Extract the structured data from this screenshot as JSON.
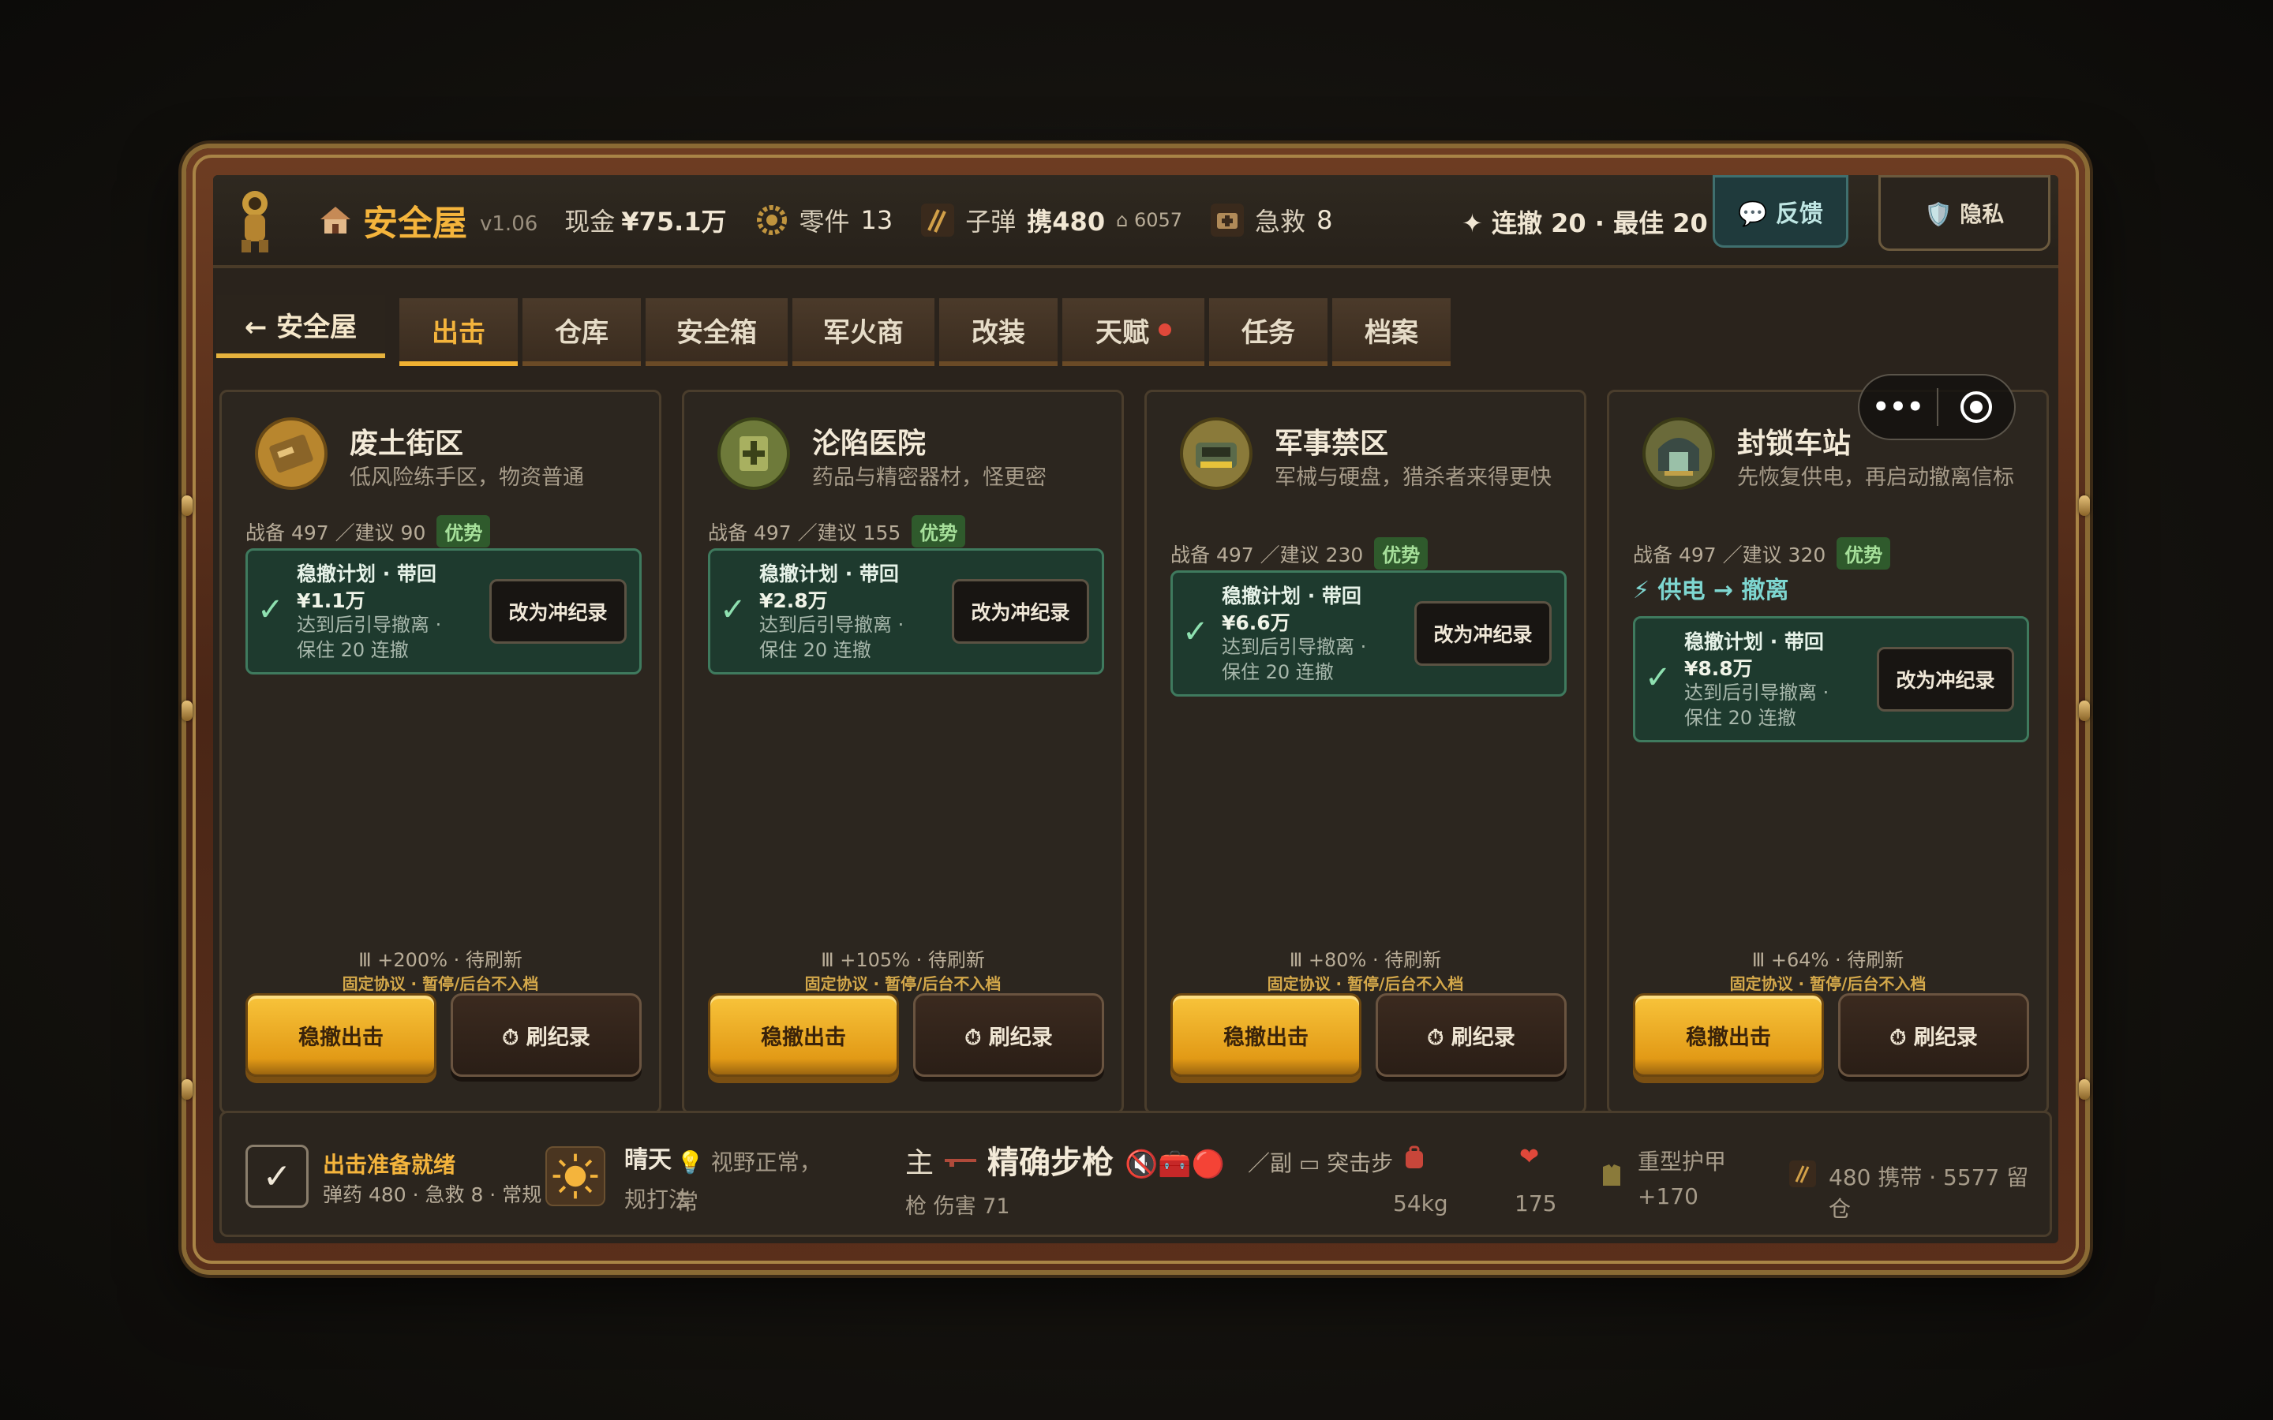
{
  "header": {
    "title": "安全屋",
    "version": "v1.06",
    "cash_label": "现金",
    "cash_value": "¥75.1万",
    "parts_label": "零件",
    "parts_value": "13",
    "ammo_label": "子弹",
    "ammo_carry": "携480",
    "ammo_stash": "⌂ 6057",
    "aid_label": "急救",
    "aid_value": "8",
    "streak": "✦ 连撤 20 · 最佳 20",
    "feedback": "💬 反馈",
    "privacy": "🛡️ 隐私"
  },
  "tabs": {
    "back": "← 安全屋",
    "items": [
      "出击",
      "仓库",
      "安全箱",
      "军火商",
      "改装",
      "天赋",
      "任务",
      "档案"
    ],
    "active": "出击"
  },
  "capsule": {
    "more": "•••"
  },
  "cards": [
    {
      "name": "废土街区",
      "desc": "低风险练手区，物资普通",
      "stats": "战备 497 ／建议 90",
      "badge": "优势",
      "plan_title": "稳撤计划 · 带回",
      "plan_amount": "¥1.1万",
      "plan_note": "达到后引导撤离 · 保住 20 连撤",
      "plan_button": "改为冲纪录",
      "power": "",
      "mods": "Ⅲ +200% · 待刷新",
      "protocol": "固定协议 · 暂停/后台不入档",
      "go": "稳撤出击",
      "record": "⏱ 刷纪录"
    },
    {
      "name": "沦陷医院",
      "desc": "药品与精密器材，怪更密",
      "stats": "战备 497 ／建议 155",
      "badge": "优势",
      "plan_title": "稳撤计划 · 带回",
      "plan_amount": "¥2.8万",
      "plan_note": "达到后引导撤离 · 保住 20 连撤",
      "plan_button": "改为冲纪录",
      "power": "",
      "mods": "Ⅲ +105% · 待刷新",
      "protocol": "固定协议 · 暂停/后台不入档",
      "go": "稳撤出击",
      "record": "⏱ 刷纪录"
    },
    {
      "name": "军事禁区",
      "desc": "军械与硬盘，猎杀者来得更快",
      "stats": "战备 497 ／建议 230",
      "badge": "优势",
      "plan_title": "稳撤计划 · 带回",
      "plan_amount": "¥6.6万",
      "plan_note": "达到后引导撤离 · 保住 20 连撤",
      "plan_button": "改为冲纪录",
      "power": "",
      "mods": "Ⅲ +80% · 待刷新",
      "protocol": "固定协议 · 暂停/后台不入档",
      "go": "稳撤出击",
      "record": "⏱ 刷纪录"
    },
    {
      "name": "封锁车站",
      "desc": "先恢复供电，再启动撤离信标",
      "stats": "战备 497 ／建议 320",
      "badge": "优势",
      "plan_title": "稳撤计划 · 带回",
      "plan_amount": "¥8.8万",
      "plan_note": "达到后引导撤离 · 保住 20 连撤",
      "plan_button": "改为冲纪录",
      "power": "⚡ 供电 → 撤离",
      "mods": "Ⅲ +64% · 待刷新",
      "protocol": "固定协议 · 暂停/后台不入档",
      "go": "稳撤出击",
      "record": "⏱ 刷纪录"
    }
  ],
  "status": {
    "check": "✓",
    "ready": "出击准备就绪",
    "ammo": "弹药 480 · 急救 8 · 常规",
    "weather": "晴天",
    "weather_desc": "💡 视野正常，常",
    "weather_desc2": "规打法",
    "main_label": "主",
    "weapon": "精确步枪",
    "weapon_icons": "🔇🧰🔴",
    "secondary": "／副 ▭ 突击步",
    "damage": "枪 伤害 71",
    "weight": "54kg",
    "hp": "175",
    "armor": "重型护甲 +170",
    "ammo_summary": "480 携带 · 5577 留仓"
  },
  "colors": {
    "accent": "#f4b43c",
    "plan_bg": "#1e3a2e",
    "badge": "#2f5a2c"
  }
}
